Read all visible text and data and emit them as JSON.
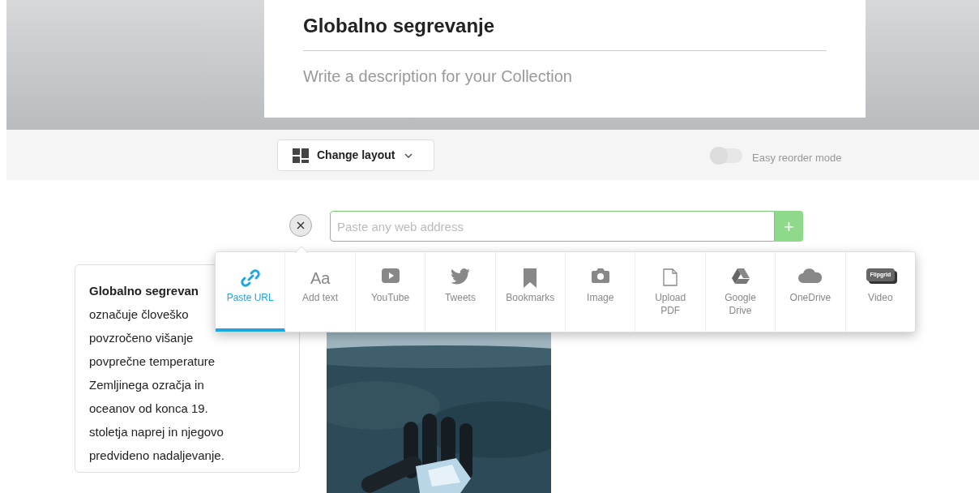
{
  "collection": {
    "title": "Globalno segrevanje",
    "description_placeholder": "Write a description for your Collection"
  },
  "toolbar": {
    "layout_button": "Change layout",
    "reorder_toggle": {
      "label": "Easy reorder mode",
      "on": false
    }
  },
  "url_input": {
    "placeholder": "Paste any web address",
    "add_button": "+"
  },
  "add_menu": [
    {
      "kind": "link",
      "label": "Paste URL",
      "selected": true
    },
    {
      "kind": "text",
      "label": "Add text",
      "icon_text": "Aa",
      "selected": false
    },
    {
      "kind": "youtube",
      "label": "YouTube",
      "selected": false
    },
    {
      "kind": "tweets",
      "label": "Tweets",
      "selected": false
    },
    {
      "kind": "bookmark",
      "label": "Bookmarks",
      "selected": false
    },
    {
      "kind": "camera",
      "label": "Image",
      "selected": false
    },
    {
      "kind": "file",
      "label": "Upload PDF",
      "selected": false
    },
    {
      "kind": "drive",
      "label": "Google Drive",
      "selected": false
    },
    {
      "kind": "cloud",
      "label": "OneDrive",
      "selected": false
    },
    {
      "kind": "flipgrid",
      "label": "Video",
      "icon_text": "Flipgrid",
      "selected": false
    }
  ],
  "text_card": {
    "lines": [
      "**Globalno segrevan**",
      "označuje človeško",
      "povzročeno višanje",
      "povprečne temperature",
      "Zemljinega ozračja in",
      "oceanov od konca 19.",
      "stoletja naprej in njegovo",
      "predvideno nadaljevanje."
    ]
  }
}
